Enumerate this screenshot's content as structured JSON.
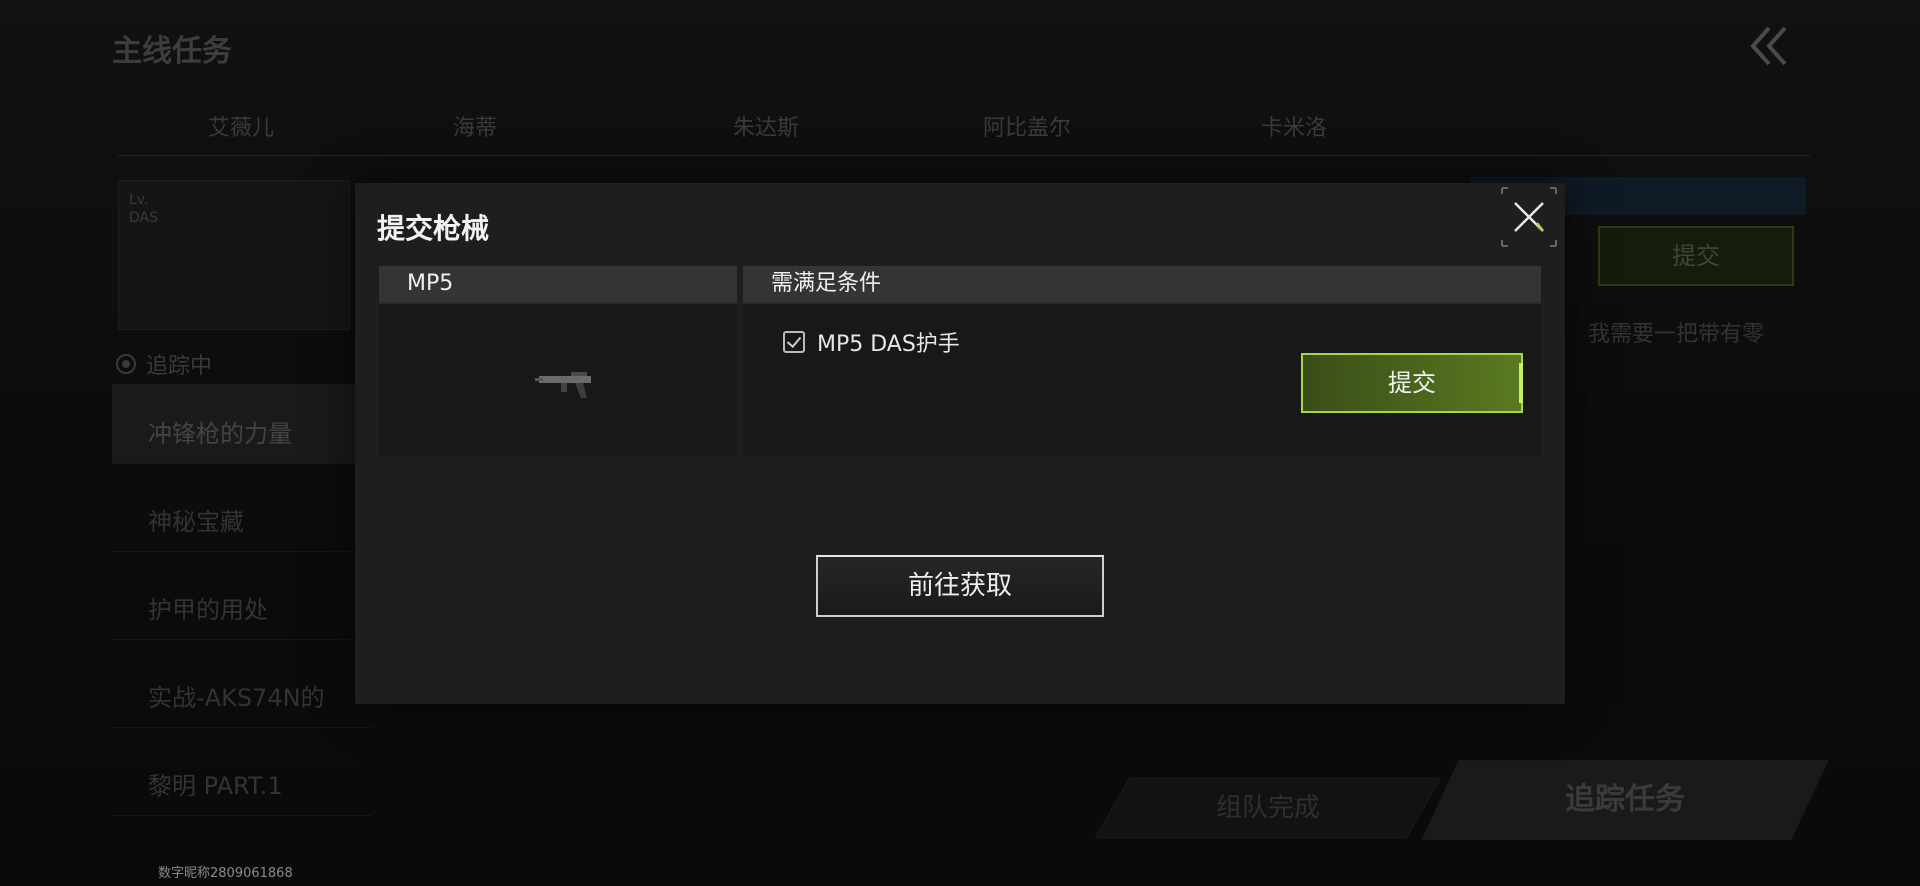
{
  "background": {
    "page_title": "主线任务",
    "tabs": [
      "艾薇儿",
      "海蒂",
      "朱达斯",
      "阿比盖尔",
      "卡米洛"
    ],
    "quest_card_text": [
      "Lv.",
      "DAS"
    ],
    "tracking_label": "追踪中",
    "quests": [
      "冲锋枪的力量",
      "神秘宝藏",
      "护甲的用处",
      "实战-AKS74N的",
      "黎明 PART.1"
    ],
    "right_submit_label": "提交",
    "right_description": "我需要一把带有零",
    "team_complete_label": "组队完成",
    "track_quest_label": "追踪任务",
    "uid_text": "数字昵称2809061868"
  },
  "modal": {
    "title": "提交枪械",
    "weapon_header": "MP5",
    "conditions_header": "需满足条件",
    "condition_item": "MP5 DAS护手",
    "submit_label": "提交",
    "acquire_label": "前往获取"
  },
  "colors": {
    "accent_green": "#a8d44a",
    "submit_fill": "#4a6a1c"
  },
  "icons": [
    "back-double-chevron-icon",
    "close-icon",
    "checkbox-icon",
    "radio-dot-icon",
    "mp5-gun-icon"
  ]
}
